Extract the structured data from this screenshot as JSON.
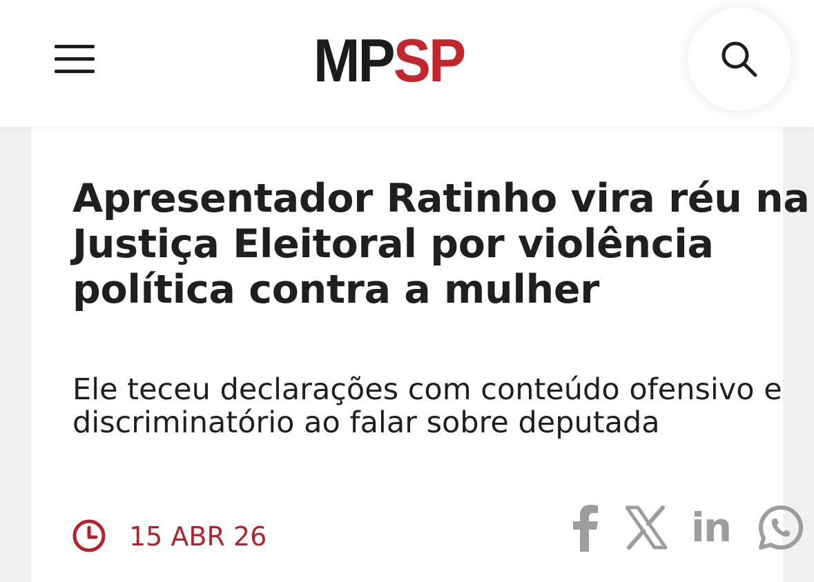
{
  "header": {
    "menu_icon": "hamburger-menu-icon",
    "logo": {
      "part1": "MP",
      "part2": "SP",
      "color_part1": "#1b1b1b",
      "color_part2": "#c1272d"
    },
    "search_icon": "search-icon"
  },
  "article": {
    "headline": "Apresentador Ratinho vira réu na Justiça Eleitoral por violência política contra a mulher",
    "subtitle": "Ele teceu declarações com conteúdo ofensivo e discriminatório ao falar sobre deputada",
    "date_icon": "clock-icon",
    "date": "15 ABR 26",
    "accent_color": "#b2232a"
  },
  "share": {
    "facebook_icon": "facebook-icon",
    "x_icon": "x-icon",
    "linkedin_label": "in",
    "whatsapp_icon": "whatsapp-icon",
    "icon_color": "#9d9d9d"
  }
}
